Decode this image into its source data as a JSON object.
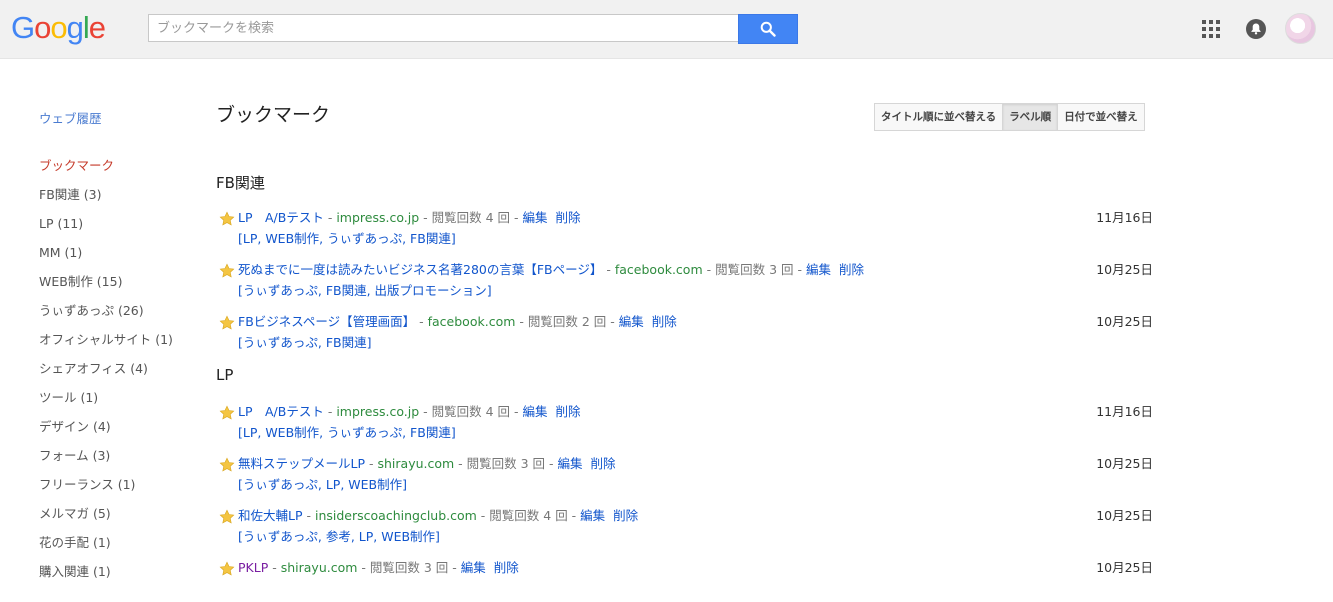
{
  "header": {
    "logo_letters": [
      {
        "ch": "G",
        "color": "#4285f4"
      },
      {
        "ch": "o",
        "color": "#ea4335"
      },
      {
        "ch": "o",
        "color": "#fbbc05"
      },
      {
        "ch": "g",
        "color": "#4285f4"
      },
      {
        "ch": "l",
        "color": "#34a853"
      },
      {
        "ch": "e",
        "color": "#ea4335"
      }
    ],
    "search_placeholder": "ブックマークを検索",
    "search_icon": "search-icon",
    "apps_icon": "apps-grid-icon",
    "notifications_icon": "bell-icon"
  },
  "sidebar": {
    "web_history": "ウェブ履歴",
    "bookmarks": "ブックマーク",
    "labels": [
      "FB関連 (3)",
      "LP (11)",
      "MM (1)",
      "WEB制作 (15)",
      "うぃずあっぷ (26)",
      "オフィシャルサイト (1)",
      "シェアオフィス (4)",
      "ツール (1)",
      "デザイン (4)",
      "フォーム (3)",
      "フリーランス (1)",
      "メルマガ (5)",
      "花の手配 (1)",
      "購入関連 (1)"
    ]
  },
  "main": {
    "title": "ブックマーク",
    "sort_buttons": [
      "タイトル順に並べ替える",
      "ラベル順",
      "日付で並べ替え"
    ],
    "selected_sort": 1,
    "sections": [
      {
        "name": "FB関連",
        "items": [
          {
            "title": "LP　A/Bテスト",
            "domain": "impress.co.jp",
            "views": "閲覧回数 4 回",
            "labels": "[LP, WEB制作, うぃずあっぷ, FB関連]",
            "date": "11月16日",
            "visited": false
          },
          {
            "title": "死ぬまでに一度は読みたいビジネス名著280の言葉【FBページ】",
            "domain": "facebook.com",
            "views": "閲覧回数 3 回",
            "labels": "[うぃずあっぷ, FB関連, 出版プロモーション]",
            "date": "10月25日",
            "visited": false
          },
          {
            "title": "FBビジネスページ【管理画面】",
            "domain": "facebook.com",
            "views": "閲覧回数 2 回",
            "labels": "[うぃずあっぷ, FB関連]",
            "date": "10月25日",
            "visited": false
          }
        ]
      },
      {
        "name": "LP",
        "items": [
          {
            "title": "LP　A/Bテスト",
            "domain": "impress.co.jp",
            "views": "閲覧回数 4 回",
            "labels": "[LP, WEB制作, うぃずあっぷ, FB関連]",
            "date": "11月16日",
            "visited": false
          },
          {
            "title": "無料ステップメールLP",
            "domain": "shirayu.com",
            "views": "閲覧回数 3 回",
            "labels": "[うぃずあっぷ, LP, WEB制作]",
            "date": "10月25日",
            "visited": false
          },
          {
            "title": "和佐大輔LP",
            "domain": "insiderscoachingclub.com",
            "views": "閲覧回数 4 回",
            "labels": "[うぃずあっぷ, 参考, LP, WEB制作]",
            "date": "10月25日",
            "visited": false
          },
          {
            "title": "PKLP",
            "domain": "shirayu.com",
            "views": "閲覧回数 3 回",
            "labels": "",
            "date": "10月25日",
            "visited": true
          }
        ]
      }
    ],
    "edit_label": "編集",
    "delete_label": "削除",
    "separator": " - "
  },
  "colors": {
    "link": "#1155cc",
    "domain": "#2e8b3e",
    "active_label": "#c53929",
    "search_button": "#4285f4",
    "star": "#f4c542"
  }
}
